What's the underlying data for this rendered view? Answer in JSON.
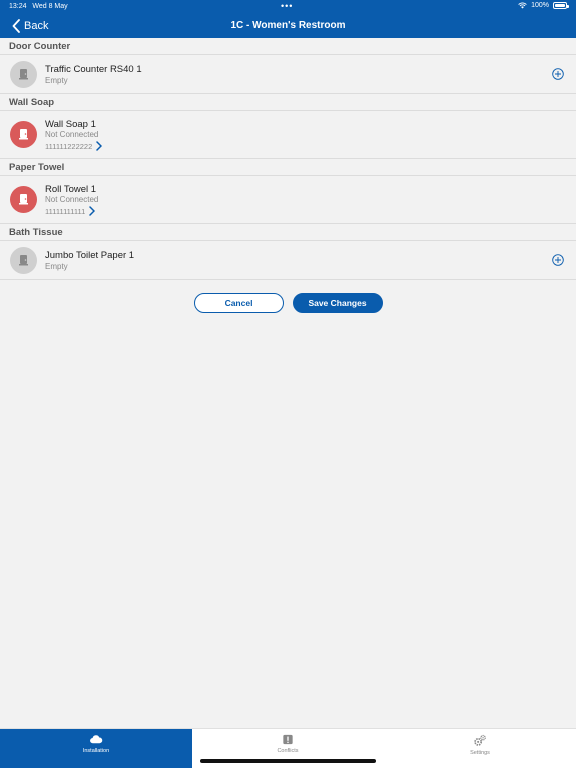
{
  "status_bar": {
    "time": "13:24",
    "date": "Wed 8 May",
    "battery": "100%"
  },
  "header": {
    "back_label": "Back",
    "title": "1C - Women's Restroom"
  },
  "sections": [
    {
      "title": "Door Counter",
      "device": {
        "name": "Traffic Counter RS40 1",
        "status": "Empty"
      }
    },
    {
      "title": "Wall Soap",
      "device": {
        "name": "Wall Soap 1",
        "status": "Not Connected",
        "serial": "111111222222"
      }
    },
    {
      "title": "Paper Towel",
      "device": {
        "name": "Roll Towel 1",
        "status": "Not Connected",
        "serial": "11111111111"
      }
    },
    {
      "title": "Bath Tissue",
      "device": {
        "name": "Jumbo Toilet Paper 1",
        "status": "Empty"
      }
    }
  ],
  "actions": {
    "cancel_label": "Cancel",
    "save_label": "Save Changes"
  },
  "tabs": [
    {
      "label": "Installation",
      "icon": "cloud-icon",
      "active": true
    },
    {
      "label": "Conflicts",
      "icon": "alert-icon",
      "active": false
    },
    {
      "label": "Settings",
      "icon": "gears-icon",
      "active": false
    }
  ],
  "colors": {
    "brand": "#0a5cad",
    "error": "#d95a5a",
    "neutral_icon": "#cfcfcf"
  }
}
